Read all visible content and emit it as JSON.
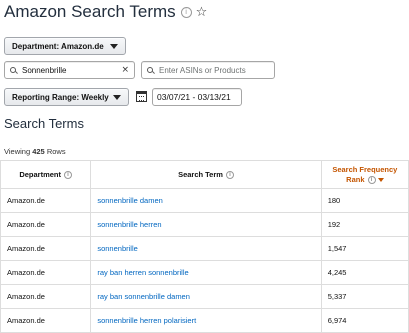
{
  "page": {
    "title": "Amazon Search Terms",
    "info_icon": "info-icon",
    "star_icon": "star-outline-icon"
  },
  "filters": {
    "department_label": "Department: Amazon.de",
    "search_value": "Sonnenbrille",
    "clear_icon": "close-icon",
    "asin_placeholder": "Enter ASINs or Products",
    "reporting_label": "Reporting Range: Weekly",
    "date_range": "03/07/21 - 03/13/21"
  },
  "section": {
    "title": "Search Terms",
    "viewing_prefix": "Viewing ",
    "viewing_count": "425",
    "viewing_suffix": " Rows"
  },
  "table": {
    "headers": {
      "department": "Department",
      "search_term": "Search Term",
      "rank_line1": "Search Frequency",
      "rank_line2": "Rank"
    },
    "rows": [
      {
        "department": "Amazon.de",
        "term": "sonnenbrille damen",
        "rank": "180"
      },
      {
        "department": "Amazon.de",
        "term": "sonnenbrille herren",
        "rank": "192"
      },
      {
        "department": "Amazon.de",
        "term": "sonnenbrille",
        "rank": "1,547"
      },
      {
        "department": "Amazon.de",
        "term": "ray ban herren sonnenbrille",
        "rank": "4,245"
      },
      {
        "department": "Amazon.de",
        "term": "ray ban sonnenbrille damen",
        "rank": "5,337"
      },
      {
        "department": "Amazon.de",
        "term": "sonnenbrille herren polarisiert",
        "rank": "6,974"
      }
    ]
  },
  "colors": {
    "link": "#0066c0",
    "sort_accent": "#c45500",
    "title": "#232f3e"
  }
}
